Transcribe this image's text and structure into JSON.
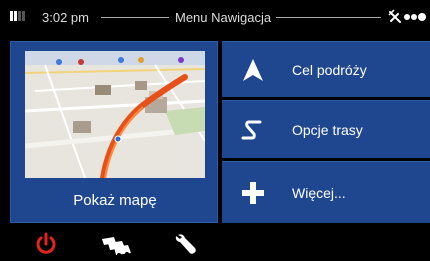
{
  "status": {
    "time": "3:02 pm",
    "title": "Menu Nawigacja",
    "icons": [
      "signal-icon",
      "satellite-icon",
      "gps-status-dots-icon"
    ]
  },
  "map_panel": {
    "label": "Pokaż mapę",
    "icon": "map-preview"
  },
  "menu_buttons": [
    {
      "label": "Cel podróży",
      "icon": "navigation-arrow-icon"
    },
    {
      "label": "Opcje trasy",
      "icon": "route-s-icon"
    },
    {
      "label": "Więcej...",
      "icon": "plus-icon"
    }
  ],
  "bottom_bar": {
    "icons": [
      "power-icon",
      "traffic-icon",
      "wrench-icon"
    ]
  },
  "colors": {
    "panel": "#1f4790",
    "power": "#e3241b",
    "route": "#e8501a",
    "background": "#000000"
  }
}
